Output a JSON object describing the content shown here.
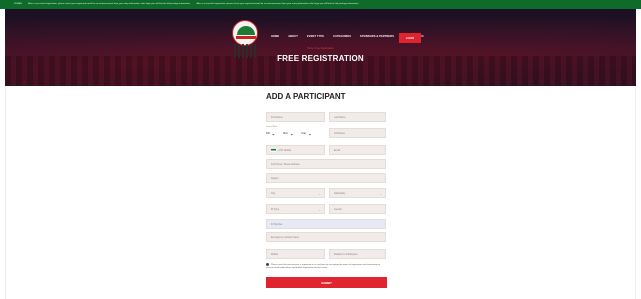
{
  "topbar": {
    "label": "ZUMBA",
    "messages": [
      "After a successful registration, please check your registered email for an announcement from your entry information; after login you will find the full package information",
      "After a successful registration, please check your registered email for an announcement from your entry information; after login you will find the full package information"
    ]
  },
  "header": {
    "nav": [
      "HOME",
      "ABOUT",
      "EVENT TYPE",
      "CATEGORIES",
      "SPONSORS & PARTNERS",
      "CONTACT INFO"
    ],
    "cta": "LOGIN",
    "breadcrumb": "Home / Free Registration",
    "title": "FREE REGISTRATION"
  },
  "form": {
    "title": "ADD A PARTICIPANT",
    "first_name": "First Name",
    "last_name": "Last Name",
    "dob_label": "Date of Birth",
    "dob_day": "DD",
    "dob_month": "Mon",
    "dob_year": "Year",
    "full_name": "Full Name",
    "phone_code": "+971",
    "phone": "Mobile",
    "email": "Email",
    "address": "Full Home / Street Address",
    "region": "Region",
    "city": "City",
    "nationality": "Nationality",
    "id_type": "ID Type",
    "gender": "Gender",
    "id_number": "ID Number",
    "emergency_name": "Emergency Contact Name",
    "emergency_phone": "Mobile",
    "emergency_relation": "Relation to Participant",
    "consent": "Please note that your privacy is important to us and you are accepting the terms of registration and consenting to receive email notifications and further registration for this event.",
    "submit": "SUBMIT"
  },
  "colors": {
    "accent": "#e0242f",
    "topbar": "#0f6b2a",
    "field_bg": "#f1ecea"
  }
}
